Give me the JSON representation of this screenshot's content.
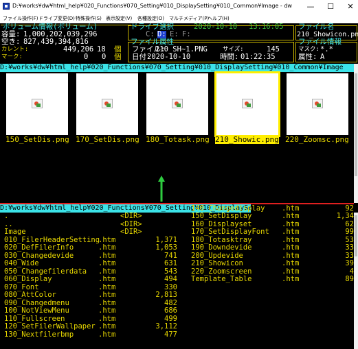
{
  "window": {
    "title": "D:¥works¥dw¥html_help¥020_Functions¥070_Setting¥010_DisplaySetting¥010_Common¥Image - dw",
    "minimize": "—",
    "maximize": "☐",
    "close": "✕"
  },
  "menu": [
    "ファイル操作(F)",
    "ドライブ変更(D)",
    "特殊操作(S)",
    "表示設定(V)",
    "各種設定(O)",
    "マルチメディア(P)",
    "ヘルプ(H)"
  ],
  "volume": {
    "header": "ボリューム情報(ボリューム)",
    "capacity_label": "容量:",
    "capacity": "1,000,202,039,296",
    "free_label": "空き:",
    "free": "827,439,394,816",
    "current_label": "カレント:",
    "current_size": "449,206",
    "current_count": "18",
    "count_unit": "個",
    "mark_label": "マーク:",
    "mark_size": "0",
    "mark_count": "0"
  },
  "drive": {
    "header": "ドライブ選択",
    "date": "2020-10-10",
    "time": "13:16:05",
    "c": "C:",
    "d": "D:",
    "e": "E:",
    "f": "F:"
  },
  "file_attr": {
    "header": "ファイル属性",
    "file_label": "ファイル:",
    "file": "210_SH~1.PNG",
    "size_label": "サイズ:",
    "size": "145",
    "date_label": "日付:",
    "date": "2020-10-10",
    "time_label": "時間:",
    "time": "01:22:35"
  },
  "file_name": {
    "header": "ファイル名",
    "value": "210_Showicon.png"
  },
  "file_info": {
    "header": "ファイル情報",
    "mask_label": "マスク:",
    "mask": "*.*",
    "attr_label": "属性:",
    "attr": "A"
  },
  "paths": {
    "top": "D:¥works¥dw¥html_help¥020_Functions¥070_Setting¥010_DisplaySetting¥010_Common¥Image",
    "bottom": "D:¥works¥dw¥html_help¥020_Functions¥070_Setting¥010_DisplaySetti"
  },
  "thumbnails": [
    {
      "name": "150_SetDis.png",
      "selected": false
    },
    {
      "name": "170_SetDis.png",
      "selected": false
    },
    {
      "name": "180_Totask.png",
      "selected": false
    },
    {
      "name": "210_Showic.png",
      "selected": true
    },
    {
      "name": "220_Zoomsc.png",
      "selected": false
    }
  ],
  "list_left": [
    {
      "name": ".",
      "ext": "",
      "size": "<DIR>"
    },
    {
      "name": "..",
      "ext": "",
      "size": "<DIR>"
    },
    {
      "name": "Image",
      "ext": "",
      "size": "<DIR>"
    },
    {
      "name": "010_FilerHeaderSetting",
      "ext": ".htm",
      "size": "1,371"
    },
    {
      "name": "020_DefFilerInfo",
      "ext": ".htm",
      "size": "1,053"
    },
    {
      "name": "030_Changedevide",
      "ext": ".htm",
      "size": "741"
    },
    {
      "name": "040_Wide",
      "ext": ".htm",
      "size": "631"
    },
    {
      "name": "050_Changefilerdata",
      "ext": ".htm",
      "size": "543"
    },
    {
      "name": "060_Display",
      "ext": ".htm",
      "size": "494"
    },
    {
      "name": "070_Font",
      "ext": ".htm",
      "size": "330"
    },
    {
      "name": "080_AttColor",
      "ext": ".htm",
      "size": "2,813"
    },
    {
      "name": "090_Changedmenu",
      "ext": ".htm",
      "size": "482"
    },
    {
      "name": "100_NotViewMenu",
      "ext": ".htm",
      "size": "686"
    },
    {
      "name": "110_Fullscreen",
      "ext": ".htm",
      "size": "499"
    },
    {
      "name": "120_SetFilerWallpaper",
      "ext": ".htm",
      "size": "3,112"
    },
    {
      "name": "130_Nextfilerbmp",
      "ext": ".htm",
      "size": "477"
    }
  ],
  "list_right": [
    {
      "name": "140_Changedisplay",
      "ext": ".htm",
      "size": "92"
    },
    {
      "name": "150_SetDisplay",
      "ext": ".htm",
      "size": "1,34"
    },
    {
      "name": "160_Displayset",
      "ext": ".htm",
      "size": "62"
    },
    {
      "name": "170_SetDisplayFont",
      "ext": ".htm",
      "size": "99"
    },
    {
      "name": "180_Totasktray",
      "ext": ".htm",
      "size": "53"
    },
    {
      "name": "190_Downdevide",
      "ext": ".htm",
      "size": "33"
    },
    {
      "name": "200_Updevide",
      "ext": ".htm",
      "size": "33"
    },
    {
      "name": "210_Showicon",
      "ext": ".htm",
      "size": "39"
    },
    {
      "name": "220_Zoomscreen",
      "ext": ".htm",
      "size": "4"
    },
    {
      "name": "Template_Table",
      "ext": ".htm",
      "size": "89"
    }
  ],
  "colors": {
    "accent_cyan": "#3be3e8",
    "yellow": "#e8d800",
    "green": "#3cc03c",
    "select": "#ffee00",
    "arrow": "#2ecc40",
    "divider_red": "#e02020"
  }
}
